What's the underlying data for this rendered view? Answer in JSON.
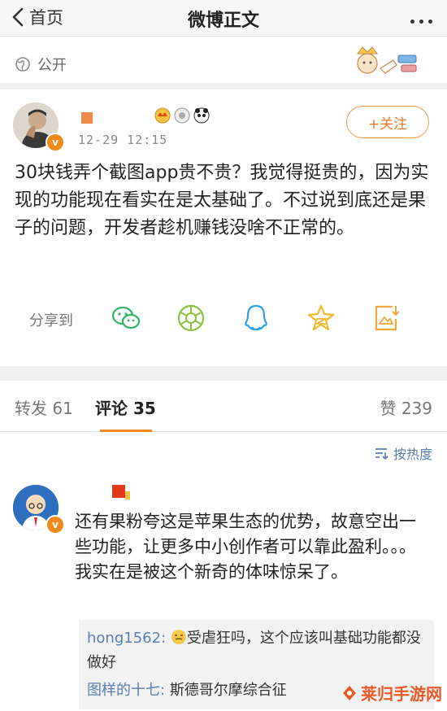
{
  "nav": {
    "back_label": "首页",
    "title": "微博正文"
  },
  "visibility": {
    "label": "公开"
  },
  "post": {
    "time": "12-29 12:15",
    "follow_label": "+关注",
    "text": "30块钱弄个截图app贵不贵？我觉得挺贵的，因为实现的功能现在看实在是太基础了。不过说到底还是果子的问题，开发者趁机赚钱没啥不正常的。"
  },
  "share": {
    "label": "分享到",
    "targets": [
      "wechat-icon",
      "moments-icon",
      "qq-icon",
      "qzone-icon",
      "save-image-icon"
    ]
  },
  "tabs": {
    "repost": "转发 61",
    "comment": "评论 35",
    "like": "赞 239"
  },
  "sort": {
    "label": "按热度"
  },
  "comment": {
    "text": "还有果粉夸这是苹果生态的优势，故意空出一些功能，让更多中小创作者可以靠此盈利。。。我实在是被这个新奇的体味惊呆了。",
    "replies": [
      {
        "user": "hong1562:",
        "text": "受虐狂吗，这个应该叫基础功能都没做好"
      },
      {
        "user": "图样的十七:",
        "text": "斯德哥尔摩综合征"
      }
    ]
  },
  "watermark": {
    "text": "莱归手游网"
  },
  "colors": {
    "accent": "#f08a1a",
    "link": "#5a7fb0",
    "follow": "#ee7a26"
  }
}
